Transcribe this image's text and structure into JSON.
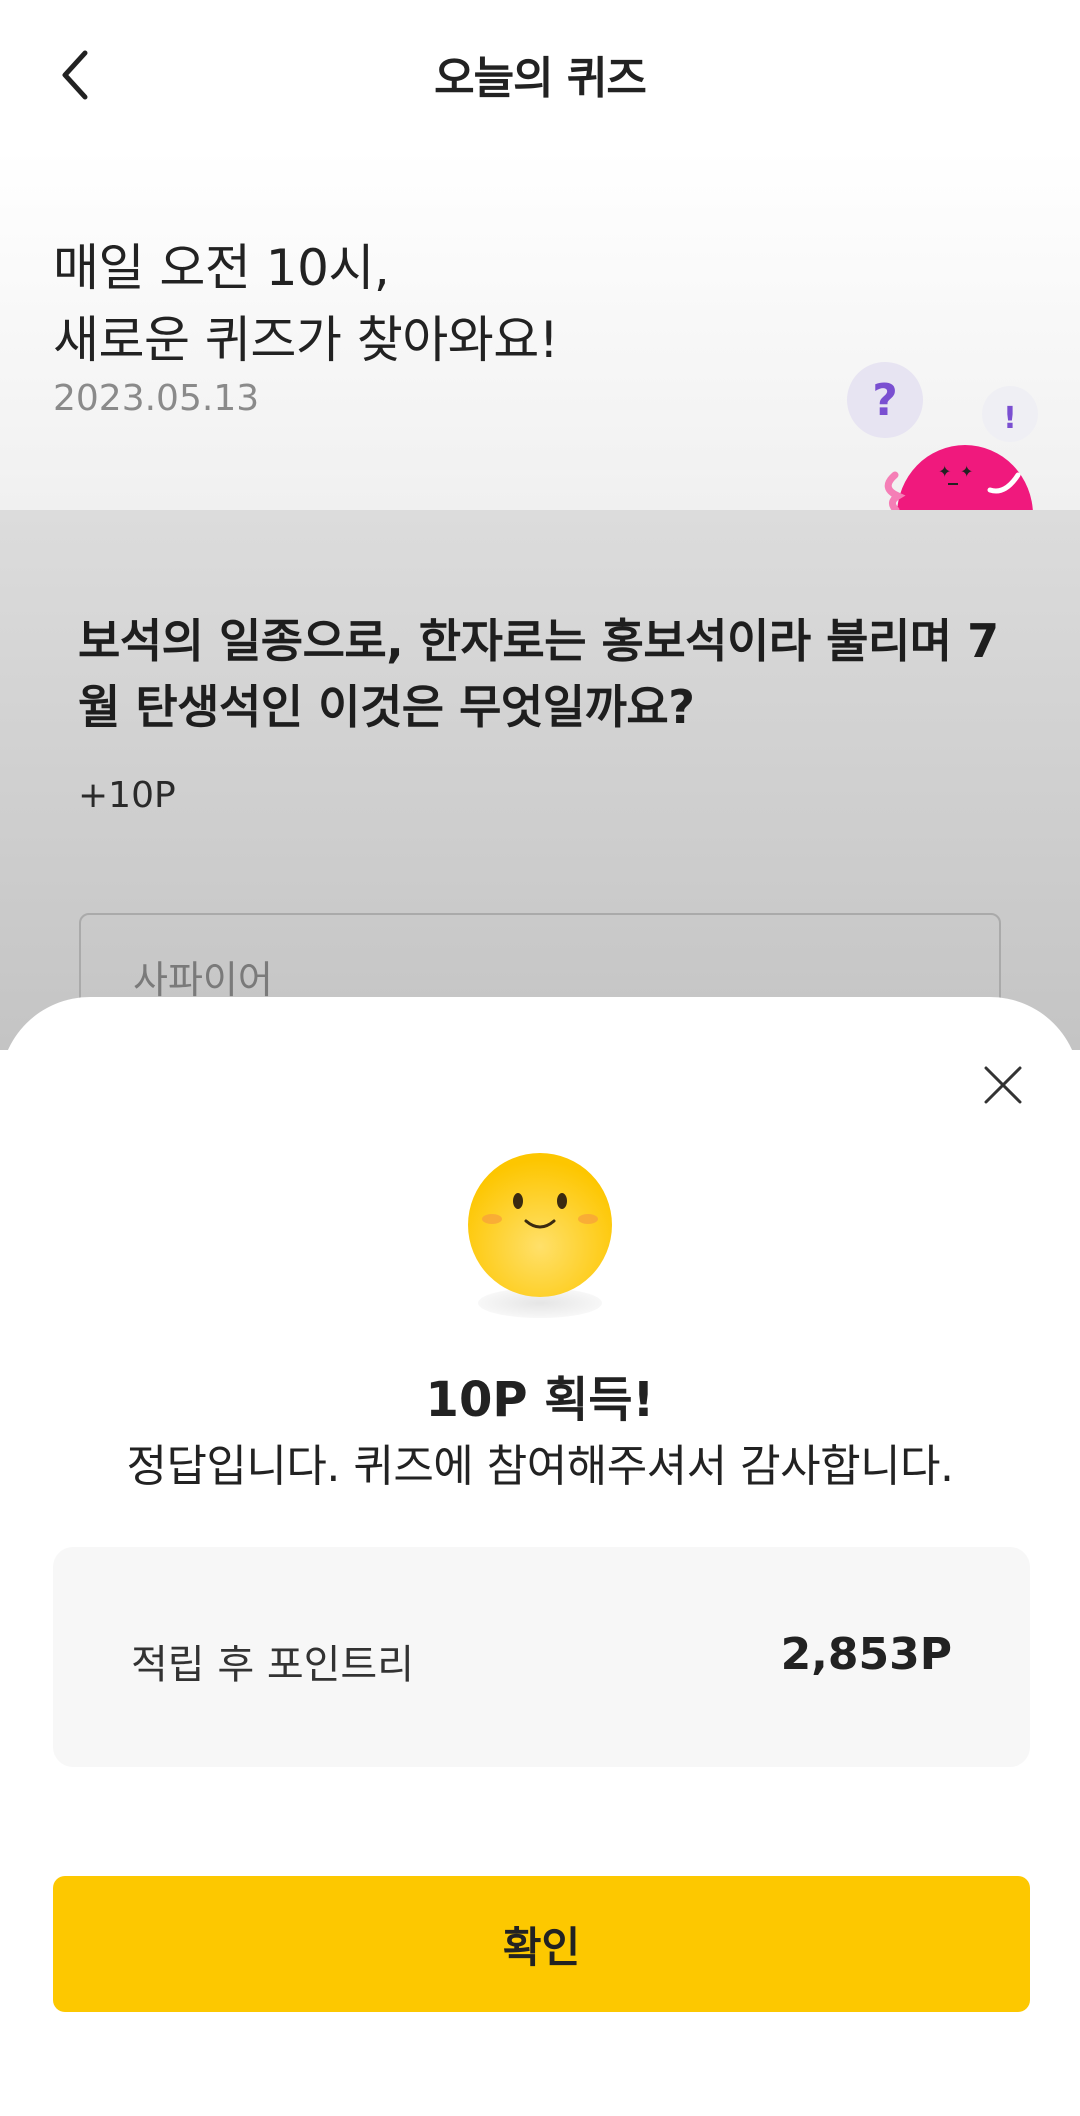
{
  "header": {
    "title": "오늘의 퀴즈",
    "back_icon": "chevron-left-icon"
  },
  "hero": {
    "line1": "매일 오전 10시,",
    "line2": "새로운 퀴즈가 찾아와요!",
    "date": "2023.05.13",
    "mascot_question_mark": "?",
    "mascot_exclaim_mark": "!"
  },
  "quiz": {
    "question": "보석의 일종으로, 한자로는 홍보석이라 불리며 7월 탄생석인 이것은 무엇일까요?",
    "reward": "+10P",
    "answer_value": "사파이어"
  },
  "result_sheet": {
    "close_icon": "close-icon",
    "emoji_icon": "smiley-face-icon",
    "earned_text": "10P 획득!",
    "message": "정답입니다. 퀴즈에 참여해주셔서 감사합니다.",
    "points_label": "적립 후 포인트리",
    "points_value": "2,853P",
    "confirm_label": "확인"
  },
  "colors": {
    "accent_yellow": "#fdc800",
    "mascot_pink": "#f0197d",
    "hint_purple": "#7a4fd1"
  }
}
